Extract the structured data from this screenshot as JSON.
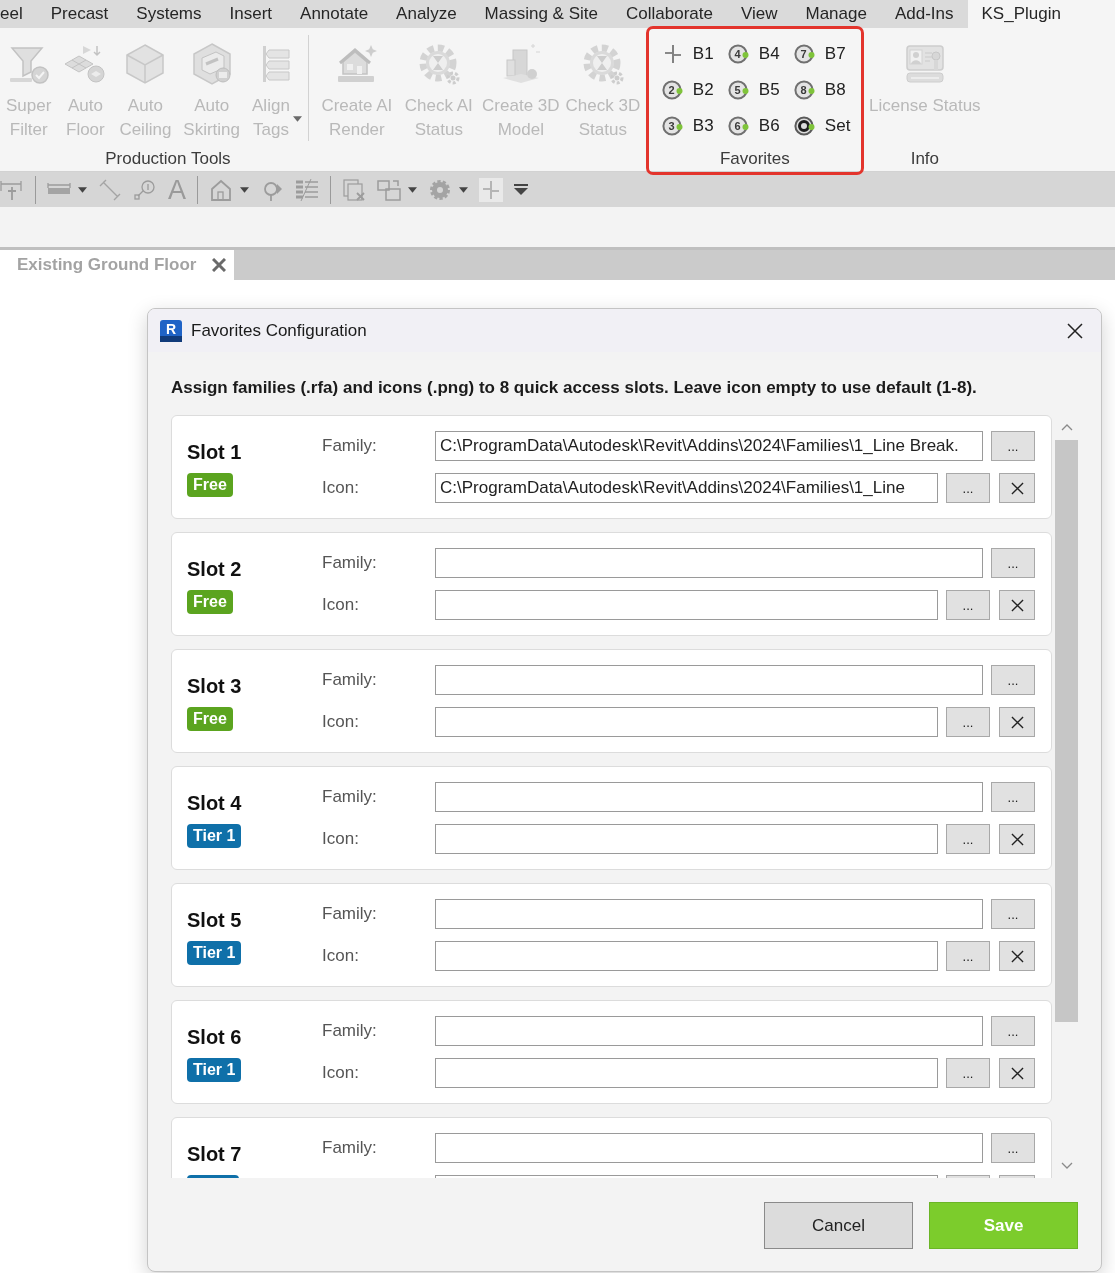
{
  "ribbon_tabs": [
    {
      "label": "eel",
      "selected": false
    },
    {
      "label": "Precast",
      "selected": false
    },
    {
      "label": "Systems",
      "selected": false
    },
    {
      "label": "Insert",
      "selected": false
    },
    {
      "label": "Annotate",
      "selected": false
    },
    {
      "label": "Analyze",
      "selected": false
    },
    {
      "label": "Massing & Site",
      "selected": false
    },
    {
      "label": "Collaborate",
      "selected": false
    },
    {
      "label": "View",
      "selected": false
    },
    {
      "label": "Manage",
      "selected": false
    },
    {
      "label": "Add-Ins",
      "selected": false
    },
    {
      "label": "KS_Plugin",
      "selected": true
    }
  ],
  "ribbon_panels": [
    {
      "kind": "large",
      "label": "Production Tools",
      "highlighted": false,
      "buttons": [
        {
          "label": "Super Filter",
          "disabled": true,
          "dropdown": false
        },
        {
          "label": "Auto Floor",
          "disabled": true,
          "dropdown": false
        },
        {
          "label": "Auto Ceiling",
          "disabled": true,
          "dropdown": false
        },
        {
          "label": "Auto Skirting",
          "disabled": true,
          "dropdown": false
        },
        {
          "label": "Align Tags",
          "disabled": true,
          "dropdown": true
        }
      ]
    },
    {
      "kind": "large",
      "highlighted": false,
      "buttons": [
        {
          "label": "Create AI Render",
          "disabled": true,
          "dropdown": false
        },
        {
          "label": "Check AI Status",
          "disabled": true,
          "dropdown": false
        },
        {
          "label": "Create 3D Model",
          "disabled": true,
          "dropdown": false
        },
        {
          "label": "Check 3D Status",
          "disabled": true,
          "dropdown": false
        }
      ]
    },
    {
      "kind": "grid",
      "label": "Favorites",
      "highlighted": true,
      "items": [
        {
          "label": "B1",
          "kind": "break"
        },
        {
          "label": "B2",
          "kind": "number",
          "number": "2"
        },
        {
          "label": "B3",
          "kind": "number",
          "number": "3"
        },
        {
          "label": "B4",
          "kind": "number",
          "number": "4"
        },
        {
          "label": "B5",
          "kind": "number",
          "number": "5"
        },
        {
          "label": "B6",
          "kind": "number",
          "number": "6"
        },
        {
          "label": "B7",
          "kind": "number",
          "number": "7"
        },
        {
          "label": "B8",
          "kind": "number",
          "number": "8"
        },
        {
          "label": "Set",
          "kind": "settings"
        }
      ]
    },
    {
      "kind": "large",
      "label": "Info",
      "highlighted": false,
      "buttons": [
        {
          "label": "License Status",
          "disabled": true,
          "dropdown": false
        }
      ]
    }
  ],
  "quick_access_toolbar": {
    "text_tool": "A"
  },
  "view_tabs": [
    {
      "label": "Existing Ground Floor",
      "selected": true
    }
  ],
  "dialog": {
    "app_icon_label": "R",
    "title": "Favorites Configuration",
    "instruction": "Assign families (.rfa) and icons (.png) to 8 quick access slots. Leave icon empty to use default (1-8).",
    "slots": [
      {
        "title": "Slot 1",
        "badge": {
          "label": "Free",
          "color": "#5ba41f"
        },
        "family": {
          "label": "Family:",
          "value": "C:\\ProgramData\\Autodesk\\Revit\\Addins\\2024\\Families\\1_Line Break.",
          "browse": "..."
        },
        "icon": {
          "label": "Icon:",
          "value": "C:\\ProgramData\\Autodesk\\Revit\\Addins\\2024\\Families\\1_Line",
          "browse": "..."
        }
      },
      {
        "title": "Slot 2",
        "badge": {
          "label": "Free",
          "color": "#5ba41f"
        },
        "family": {
          "label": "Family:",
          "browse": "..."
        },
        "icon": {
          "label": "Icon:",
          "browse": "..."
        }
      },
      {
        "title": "Slot 3",
        "badge": {
          "label": "Free",
          "color": "#5ba41f"
        },
        "family": {
          "label": "Family:",
          "browse": "..."
        },
        "icon": {
          "label": "Icon:",
          "browse": "..."
        }
      },
      {
        "title": "Slot 4",
        "badge": {
          "label": "Tier 1",
          "color": "#0f70a9"
        },
        "family": {
          "label": "Family:",
          "browse": "..."
        },
        "icon": {
          "label": "Icon:",
          "browse": "..."
        }
      },
      {
        "title": "Slot 5",
        "badge": {
          "label": "Tier 1",
          "color": "#0f70a9"
        },
        "family": {
          "label": "Family:",
          "browse": "..."
        },
        "icon": {
          "label": "Icon:",
          "browse": "..."
        }
      },
      {
        "title": "Slot 6",
        "badge": {
          "label": "Tier 1",
          "color": "#0f70a9"
        },
        "family": {
          "label": "Family:",
          "browse": "..."
        },
        "icon": {
          "label": "Icon:",
          "browse": "..."
        }
      },
      {
        "title": "Slot 7",
        "badge": {
          "color": "#0f70a9"
        },
        "family": {
          "label": "Family:",
          "browse": "..."
        }
      }
    ],
    "buttons": [
      {
        "label": "Cancel",
        "kind": "secondary"
      },
      {
        "label": "Save",
        "kind": "primary"
      }
    ]
  }
}
